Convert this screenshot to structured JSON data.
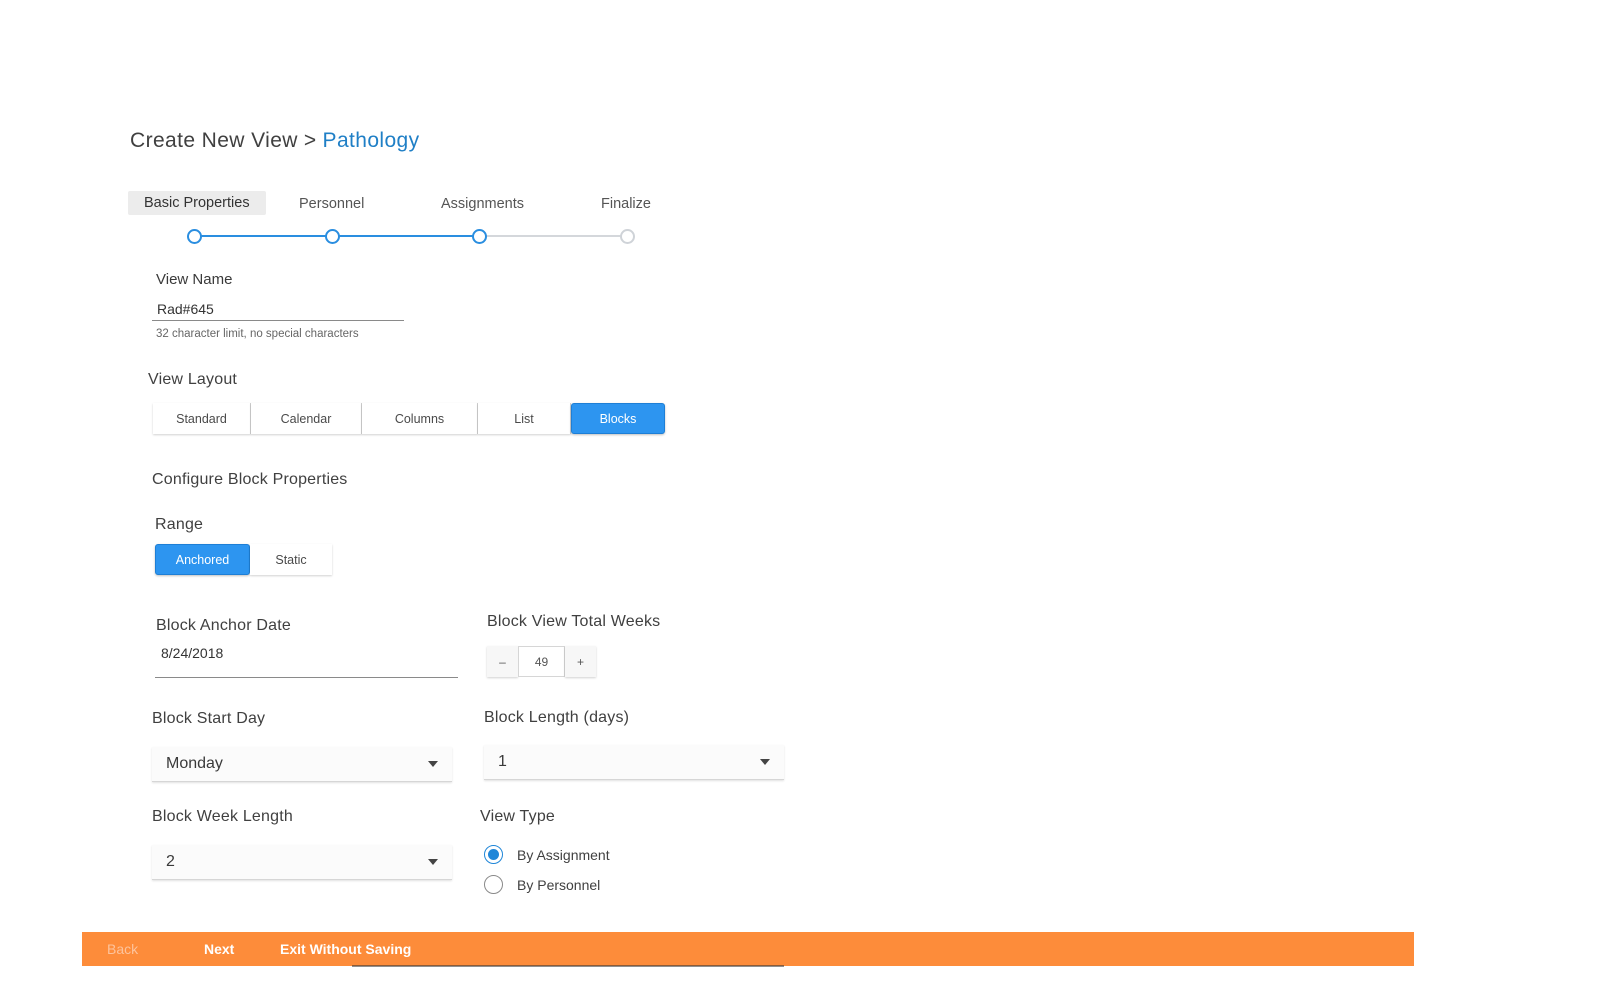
{
  "header": {
    "title": "Create New View",
    "separator": ">",
    "crumb": "Pathology"
  },
  "steps": [
    {
      "label": "Basic Properties",
      "state": "active"
    },
    {
      "label": "Personnel",
      "state": "done"
    },
    {
      "label": "Assignments",
      "state": "done"
    },
    {
      "label": "Finalize",
      "state": "todo"
    }
  ],
  "view_name": {
    "label": "View Name",
    "value": "Rad#645",
    "helper": "32 character limit, no special characters"
  },
  "view_layout": {
    "label": "View Layout",
    "options": [
      "Standard",
      "Calendar",
      "Columns",
      "List",
      "Blocks"
    ],
    "selected": "Blocks"
  },
  "config": {
    "heading": "Configure Block Properties"
  },
  "range": {
    "label": "Range",
    "options": [
      "Anchored",
      "Static"
    ],
    "selected": "Anchored"
  },
  "anchor_date": {
    "label": "Block Anchor Date",
    "value": "8/24/2018"
  },
  "total_weeks": {
    "label": "Block View Total Weeks",
    "value": "49",
    "minus": "–",
    "plus": "+"
  },
  "start_day": {
    "label": "Block Start Day",
    "value": "Monday"
  },
  "block_length": {
    "label": "Block Length (days)",
    "value": "1"
  },
  "week_length": {
    "label": "Block Week Length",
    "value": "2"
  },
  "view_type": {
    "label": "View Type",
    "options": [
      "By Assignment",
      "By Personnel"
    ],
    "selected": "By Assignment"
  },
  "footer": {
    "back": "Back",
    "next": "Next",
    "exit": "Exit Without Saving",
    "color": "#fd8c3a"
  },
  "colors": {
    "accent": "#2d95f0",
    "crumb": "#1f7fc6"
  }
}
